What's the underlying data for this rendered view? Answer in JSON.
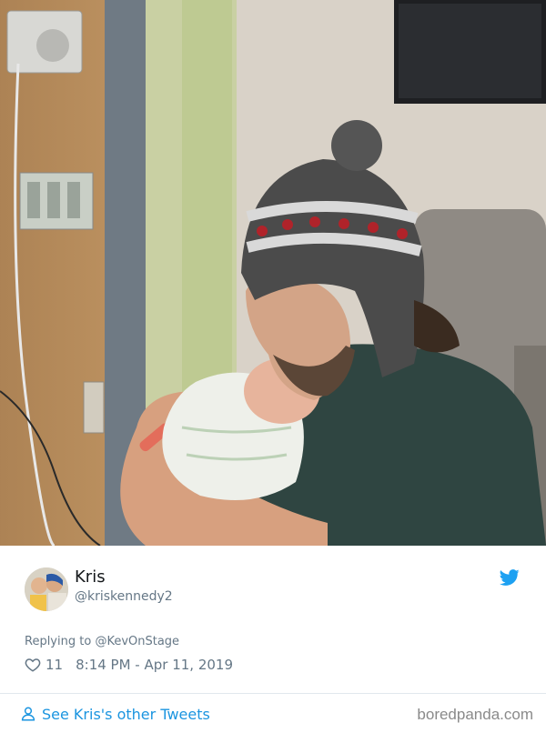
{
  "tweet": {
    "author_name": "Kris",
    "author_handle": "@kriskennedy2",
    "replying_to_prefix": "Replying to ",
    "replying_to_handle": "@KevOnStage",
    "like_count": "11",
    "timestamp": "8:14 PM - Apr 11, 2019",
    "see_more_label": "See Kris's other Tweets",
    "icons": {
      "brand": "twitter-bird-icon",
      "like": "heart-icon",
      "profile": "user-icon"
    }
  },
  "watermark": "boredpanda.com",
  "colors": {
    "link": "#1b95e0",
    "muted": "#657786",
    "divider": "#e1e8ed",
    "text": "#14171a"
  }
}
